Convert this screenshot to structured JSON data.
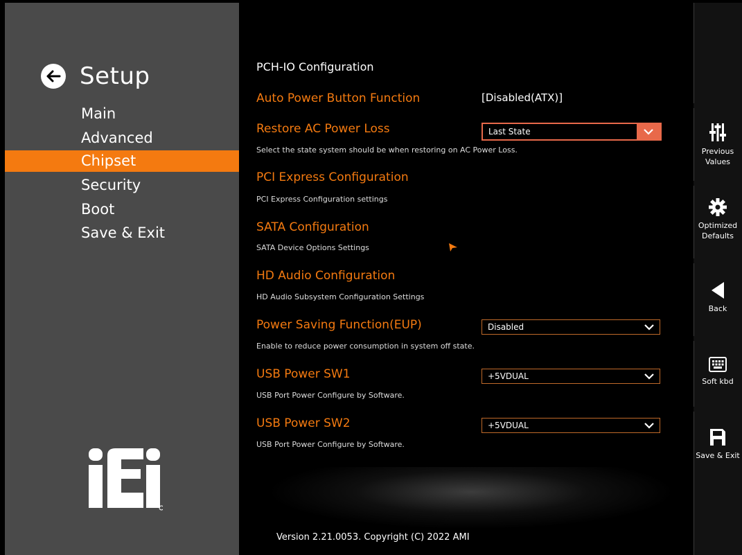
{
  "nav": {
    "title": "Setup",
    "items": [
      {
        "label": "Main",
        "active": false
      },
      {
        "label": "Advanced",
        "active": false
      },
      {
        "label": "Chipset",
        "active": true
      },
      {
        "label": "Security",
        "active": false
      },
      {
        "label": "Boot",
        "active": false
      },
      {
        "label": "Save & Exit",
        "active": false
      }
    ],
    "logo_text": "iEi"
  },
  "main": {
    "section_title": "PCH-IO Configuration",
    "options": [
      {
        "label": "Auto Power Button Function",
        "value": "[Disabled(ATX)]",
        "help": ""
      },
      {
        "label": "Restore AC Power Loss",
        "value": "Last State",
        "help": "Select the state system should be when restoring on AC Power Loss."
      },
      {
        "label": "PCI Express Configuration",
        "value": "",
        "help": "PCI Express Configuration settings"
      },
      {
        "label": "SATA Configuration",
        "value": "",
        "help": "SATA Device Options Settings"
      },
      {
        "label": "HD Audio Configuration",
        "value": "",
        "help": "HD Audio Subsystem Configuration Settings"
      },
      {
        "label": "Power Saving Function(EUP)",
        "value": "Disabled",
        "help": "Enable to reduce power consumption in system off state."
      },
      {
        "label": "USB Power SW1",
        "value": "+5VDUAL",
        "help": "USB Port Power Configure by Software."
      },
      {
        "label": "USB Power SW2",
        "value": "+5VDUAL",
        "help": "USB Port Power Configure by Software."
      }
    ],
    "version": "Version 2.21.0053. Copyright (C) 2022 AMI"
  },
  "toolbar": {
    "previous_values": "Previous\nValues",
    "previous_line1": "Previous",
    "previous_line2": "Values",
    "optimized_line1": "Optimized",
    "optimized_line2": "Defaults",
    "back": "Back",
    "soft_kbd": "Soft kbd",
    "save_exit": "Save & Exit"
  },
  "colors": {
    "accent": "#f47a10",
    "dropdown_focus": "#e8694a",
    "nav_bg": "#4a4a4a",
    "toolbar_bg": "#121212"
  }
}
